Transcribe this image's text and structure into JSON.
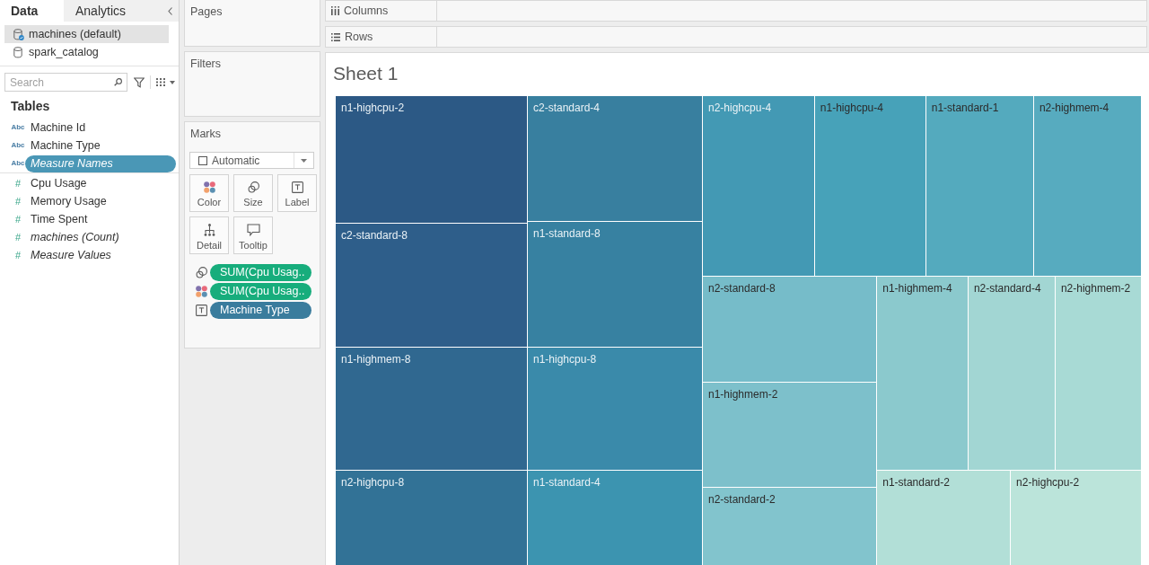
{
  "data_pane": {
    "tabs": [
      {
        "label": "Data",
        "selected": true
      },
      {
        "label": "Analytics",
        "selected": false
      }
    ],
    "sources": [
      {
        "name": "machines (default)",
        "selected": true,
        "active": true
      },
      {
        "name": "spark_catalog",
        "selected": false,
        "active": false
      }
    ],
    "search": {
      "placeholder": "Search"
    },
    "tables_heading": "Tables",
    "fields": [
      {
        "name": "Machine Id",
        "kind": "dimension",
        "type_label": "Abc",
        "generated": false,
        "selected": false
      },
      {
        "name": "Machine Type",
        "kind": "dimension",
        "type_label": "Abc",
        "generated": false,
        "selected": false
      },
      {
        "name": "Measure Names",
        "kind": "dimension",
        "type_label": "Abc",
        "generated": true,
        "selected": true
      },
      {
        "name": "Cpu Usage",
        "kind": "measure",
        "type_label": "#",
        "generated": false,
        "selected": false
      },
      {
        "name": "Memory Usage",
        "kind": "measure",
        "type_label": "#",
        "generated": false,
        "selected": false
      },
      {
        "name": "Time Spent",
        "kind": "measure",
        "type_label": "#",
        "generated": false,
        "selected": false
      },
      {
        "name": "machines (Count)",
        "kind": "measure",
        "type_label": "#",
        "generated": true,
        "selected": false
      },
      {
        "name": "Measure Values",
        "kind": "measure",
        "type_label": "#",
        "generated": true,
        "selected": false
      }
    ]
  },
  "cards": {
    "pages": {
      "title": "Pages"
    },
    "filters": {
      "title": "Filters"
    },
    "marks": {
      "title": "Marks",
      "mark_type": "Automatic",
      "buttons": [
        {
          "label": "Color",
          "kind": "color"
        },
        {
          "label": "Size",
          "kind": "size"
        },
        {
          "label": "Label",
          "kind": "label"
        },
        {
          "label": "Detail",
          "kind": "detail"
        },
        {
          "label": "Tooltip",
          "kind": "tooltip"
        }
      ],
      "pills": [
        {
          "kind": "size",
          "label": "SUM(Cpu Usag..",
          "color": "#17ad7c"
        },
        {
          "kind": "color",
          "label": "SUM(Cpu Usag..",
          "color": "#17ad7c"
        },
        {
          "kind": "label",
          "label": "Machine Type",
          "color": "#3a7c9d"
        }
      ]
    }
  },
  "shelves": [
    {
      "label": "Columns",
      "kind": "columns"
    },
    {
      "label": "Rows",
      "kind": "rows"
    }
  ],
  "sheet": {
    "title": "Sheet 1",
    "treemap": {
      "tiles": [
        {
          "label": "n1-highcpu-2",
          "color": "#2c5985"
        },
        {
          "label": "c2-standard-8",
          "color": "#2e5e8a"
        },
        {
          "label": "n1-highmem-8",
          "color": "#306890"
        },
        {
          "label": "n2-highcpu-8",
          "color": "#327296"
        },
        {
          "label": "c2-standard-4",
          "color": "#387f9f"
        },
        {
          "label": "n1-standard-8",
          "color": "#3781a1"
        },
        {
          "label": "n1-highcpu-8",
          "color": "#3a8aaa"
        },
        {
          "label": "n1-standard-4",
          "color": "#3c94b0"
        },
        {
          "label": "n2-highcpu-4",
          "color": "#4399b4"
        },
        {
          "label": "n1-highcpu-4",
          "color": "#47a2b9"
        },
        {
          "label": "n1-standard-1",
          "color": "#54aabe"
        },
        {
          "label": "n2-highmem-4",
          "color": "#57abbf"
        },
        {
          "label": "n2-standard-8",
          "color": "#76bcc9"
        },
        {
          "label": "n1-highmem-2",
          "color": "#7dc0cb"
        },
        {
          "label": "n2-standard-2",
          "color": "#82c4cd"
        },
        {
          "label": "n1-highmem-4",
          "color": "#8bc9cd"
        },
        {
          "label": "n2-standard-4",
          "color": "#a2d6d3"
        },
        {
          "label": "n2-highmem-2",
          "color": "#a8dad5"
        },
        {
          "label": "n1-standard-2",
          "color": "#b2dfd7"
        },
        {
          "label": "n2-highcpu-2",
          "color": "#bbe4da"
        }
      ]
    }
  }
}
